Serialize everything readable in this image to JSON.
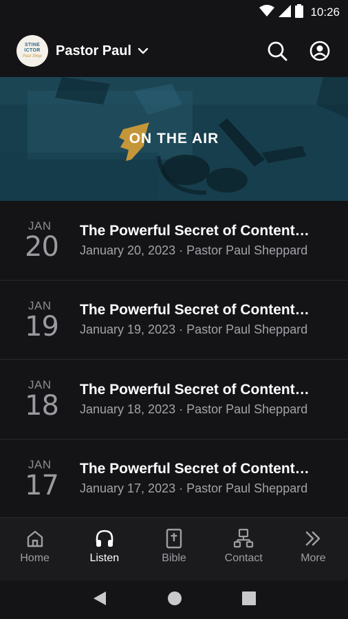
{
  "status_bar": {
    "time": "10:26",
    "icons": [
      "wifi-icon",
      "signal-icon",
      "battery-icon"
    ]
  },
  "header": {
    "avatar": {
      "line1": "STINE",
      "line2": "ICTOR",
      "line3": "Paul Shep"
    },
    "title": "Pastor Paul",
    "actions": [
      "search-icon",
      "account-icon"
    ]
  },
  "banner": {
    "text": "ON THE AIR",
    "accent_color": "#c4963a",
    "background_color": "#173e4c"
  },
  "episodes": [
    {
      "month": "JAN",
      "day": "20",
      "title": "The Powerful Secret of Content…",
      "meta": "January 20, 2023 · Pastor Paul Sheppard"
    },
    {
      "month": "JAN",
      "day": "19",
      "title": "The Powerful Secret of Content…",
      "meta": "January 19, 2023 · Pastor Paul Sheppard"
    },
    {
      "month": "JAN",
      "day": "18",
      "title": "The Powerful Secret of Content…",
      "meta": "January 18, 2023 · Pastor Paul Sheppard"
    },
    {
      "month": "JAN",
      "day": "17",
      "title": "The Powerful Secret of Content…",
      "meta": "January 17, 2023 · Pastor Paul Sheppard"
    }
  ],
  "bottom_nav": [
    {
      "label": "Home",
      "icon": "home-icon",
      "active": false
    },
    {
      "label": "Listen",
      "icon": "headphones-icon",
      "active": true
    },
    {
      "label": "Bible",
      "icon": "bible-icon",
      "active": false
    },
    {
      "label": "Contact",
      "icon": "contact-icon",
      "active": false
    },
    {
      "label": "More",
      "icon": "more-icon",
      "active": false
    }
  ],
  "system_nav": [
    "back-icon",
    "home-circle-icon",
    "recents-icon"
  ],
  "colors": {
    "background": "#141417",
    "nav_background": "#1b1b1e",
    "muted_text": "#a3a3a8"
  }
}
